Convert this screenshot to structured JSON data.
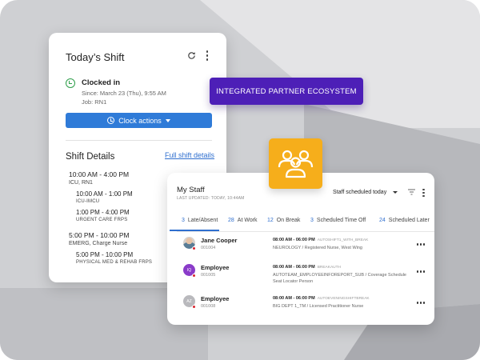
{
  "colors": {
    "background": "#cfd0d3",
    "primary_blue": "#2f7bd8",
    "banner_purple": "#4d1fb7",
    "tile_orange": "#f6ae1b",
    "clocked_in_green": "#2e9e4a",
    "status_red": "#d9232e"
  },
  "shift_card": {
    "title": "Today’s Shift",
    "status": "Clocked in",
    "since": "Since: March 23 (Thu), 9:55 AM",
    "job": "Job: RN1",
    "clock_actions_label": "Clock actions",
    "shift_details_title": "Shift Details",
    "full_shift_link": "Full shift details",
    "shifts": [
      {
        "time": "10:00 AM - 4:00 PM",
        "location": "ICU, RN1",
        "segments": [
          {
            "time": "10:00 AM - 1:00 PM",
            "unit": "ICU-IMCU"
          },
          {
            "time": "1:00 PM - 4:00 PM",
            "unit": "URGENT CARE FRPS"
          }
        ]
      },
      {
        "time": "5:00 PM - 10:00 PM",
        "location": "EMERG, Charge Nurse",
        "segments": [
          {
            "time": "5:00 PM - 10:00 PM",
            "unit": "PHYSICAL MED & REHAB FRPS"
          }
        ]
      }
    ]
  },
  "banner": {
    "label": "INTEGRATED PARTNER ECOSYSTEM"
  },
  "group_tile": {
    "icon": "group-people-icon"
  },
  "staff_card": {
    "title": "My Staff",
    "last_updated": "LAST UPDATED: TODAY, 10:44AM",
    "filter_value": "Staff scheduled today",
    "tabs": [
      {
        "count": "3",
        "label": "Late/Absent",
        "active": true
      },
      {
        "count": "28",
        "label": "At Work"
      },
      {
        "count": "12",
        "label": "On Break"
      },
      {
        "count": "3",
        "label": "Scheduled Time Off"
      },
      {
        "count": "24",
        "label": "Scheduled Later"
      }
    ],
    "rows": [
      {
        "name": "Jane Cooper",
        "id": "001004",
        "avatar_initials": "",
        "time": "08:00 AM - 06:00 PM",
        "schedule_code": "AUTOSHIFT1_WITH_BREAK",
        "dept_line1": "NEUROLOGY  /  Registered Nurse, West Wing",
        "dept_line2": ""
      },
      {
        "name": "Employee",
        "id": "001005",
        "avatar_initials": "IQ",
        "time": "08:00 AM - 06:00 PM",
        "schedule_code": "BREAKAUTH",
        "dept_line1": "AUTOTEAM_EMPLOYEEINFOREPORT_SUB  /  Coverage Schedule",
        "dept_line2": "Seat Locator Person"
      },
      {
        "name": "Employee",
        "id": "001008",
        "avatar_initials": "AZ",
        "time": "08:00 AM - 06:00 PM",
        "schedule_code": "AUTOEVENINGSHIFTBREAK",
        "dept_line1": "BIG DEPT 1_TM  /  Licensed Practitioner Nurse",
        "dept_line2": ""
      }
    ]
  }
}
